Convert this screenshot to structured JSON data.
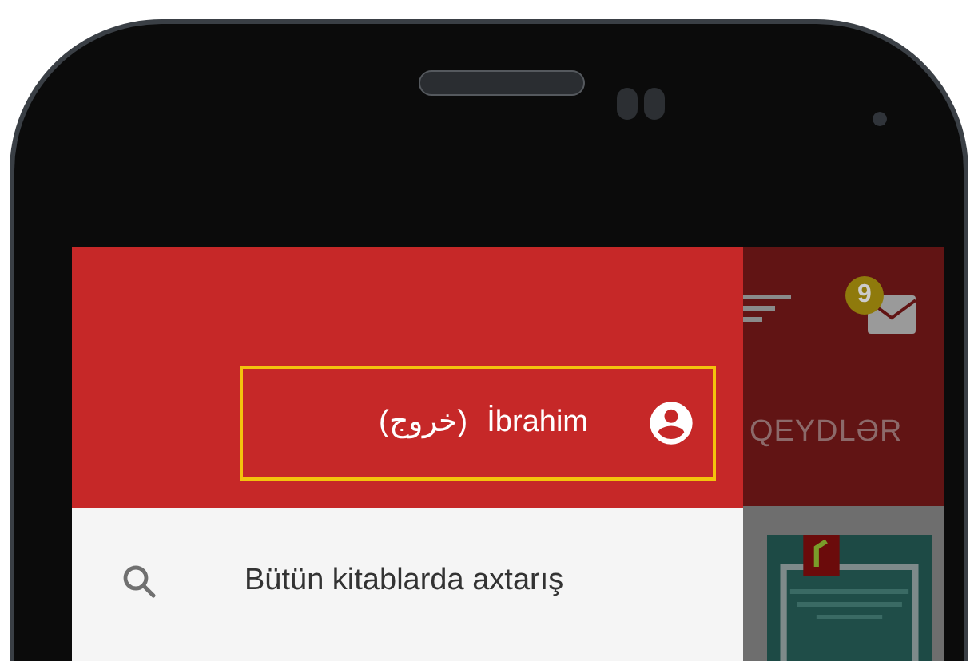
{
  "drawer": {
    "account": {
      "logout": "(خروج)",
      "name": "İbrahim",
      "highlighted": true
    },
    "items": [
      {
        "kind": "search",
        "label": "Bütün kitablarda axtarış"
      }
    ]
  },
  "app": {
    "notification_count": "9",
    "tab": "QEYDLƏR"
  }
}
